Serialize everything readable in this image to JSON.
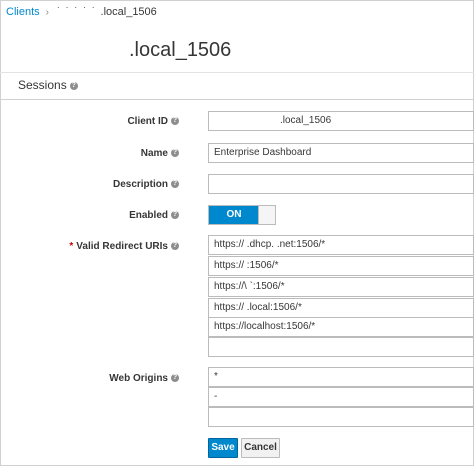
{
  "breadcrumb": {
    "parent": "Clients",
    "redacted": "˙ ˙ ˙   ˙ ˙",
    "current": ".local_1506"
  },
  "page_title": ".local_1506",
  "tabs": {
    "sessions": "Sessions"
  },
  "form": {
    "client_id_label": "Client ID",
    "client_id_value": ".local_1506",
    "name_label": "Name",
    "name_value": "Enterprise Dashboard",
    "description_label": "Description",
    "description_value": "",
    "enabled_label": "Enabled",
    "enabled_state": "ON",
    "redirect_required_marker": "*",
    "redirect_label": "Valid Redirect URIs",
    "redirect_uris": [
      "https://                .dhcp.              .net:1506/*",
      "https://                :1506/*",
      "https://\\                `:1506/*",
      "https://                .local:1506/*",
      "https://localhost:1506/*",
      ""
    ],
    "web_origins_label": "Web Origins",
    "web_origins": [
      "*",
      "-",
      ""
    ]
  },
  "buttons": {
    "save": "Save",
    "cancel": "Cancel"
  },
  "colors": {
    "accent": "#0088ce",
    "required": "#cc0000",
    "border": "#bbbbbb"
  }
}
